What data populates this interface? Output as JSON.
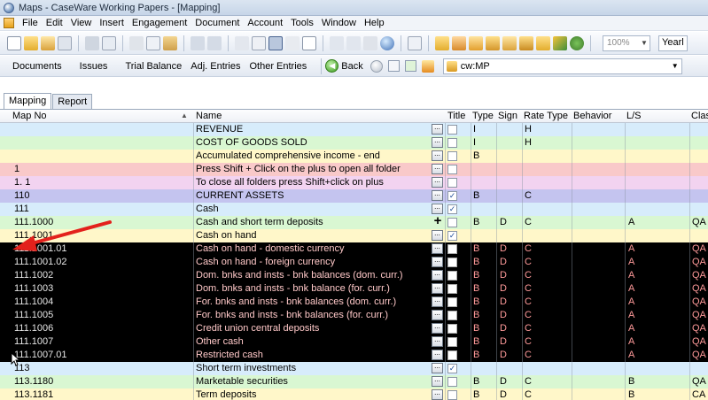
{
  "window": {
    "title": "Maps - CaseWare Working Papers - [Mapping]"
  },
  "menu": [
    "File",
    "Edit",
    "View",
    "Insert",
    "Engagement",
    "Document",
    "Account",
    "Tools",
    "Window",
    "Help"
  ],
  "toolbar": {
    "zoom": "100%",
    "period": "Yearl"
  },
  "nav": {
    "documents": "Documents",
    "issues": "Issues",
    "trial_balance": "Trial Balance",
    "adj_entries": "Adj. Entries",
    "other_entries": "Other Entries",
    "back": "Back",
    "address": "cw:MP"
  },
  "tabs": [
    "Mapping",
    "Report"
  ],
  "columns": {
    "map_no": "Map No",
    "name": "Name",
    "title": "Title",
    "type": "Type",
    "sign": "Sign",
    "rate_type": "Rate Type",
    "behavior": "Behavior",
    "ls": "L/S",
    "class": "Clas"
  },
  "colors": {
    "blue_row": "#d7ecfb",
    "green_row": "#d9f7d2",
    "yellow_row": "#fff7c9",
    "pink_row": "#f9c9c9",
    "lavender_row": "#f2d3f0",
    "purple_row": "#c4c4ef",
    "selected_row": "#000000",
    "arrow": "#e3211c"
  },
  "rows": [
    {
      "map_no": "",
      "name": "REVENUE",
      "title": false,
      "type": "I",
      "sign": "",
      "rate_type": "H",
      "ls": "",
      "cls": "",
      "bg": "#d7ecfb",
      "style": "normal"
    },
    {
      "map_no": "",
      "name": "COST OF GOODS SOLD",
      "title": false,
      "type": "I",
      "sign": "",
      "rate_type": "H",
      "ls": "",
      "cls": "",
      "bg": "#d9f7d2",
      "style": "normal"
    },
    {
      "map_no": "",
      "name": "Accumulated comprehensive income - end",
      "title": false,
      "type": "B",
      "sign": "",
      "rate_type": "",
      "ls": "",
      "cls": "",
      "bg": "#fff7c9",
      "style": "normal"
    },
    {
      "map_no": "1",
      "name": "Press Shift + Click on the plus to open all folder",
      "title": false,
      "type": "",
      "sign": "",
      "rate_type": "",
      "ls": "",
      "cls": "",
      "bg": "#f9c9c9",
      "style": "normal"
    },
    {
      "map_no": "1. 1",
      "name": "To close all folders press Shift+click on plus",
      "title": false,
      "type": "",
      "sign": "",
      "rate_type": "",
      "ls": "",
      "cls": "",
      "bg": "#f2d3f0",
      "style": "normal"
    },
    {
      "map_no": "110",
      "name": "CURRENT ASSETS",
      "title": true,
      "type": "B",
      "sign": "",
      "rate_type": "C",
      "ls": "",
      "cls": "",
      "bg": "#c4c4ef",
      "style": "normal"
    },
    {
      "map_no": "111",
      "name": "Cash",
      "title": true,
      "type": "",
      "sign": "",
      "rate_type": "",
      "ls": "",
      "cls": "",
      "bg": "#d7ecfb",
      "style": "normal"
    },
    {
      "map_no": "111.1000",
      "name": "Cash and short term deposits",
      "title": false,
      "type": "B",
      "sign": "D",
      "rate_type": "C",
      "ls": "A",
      "cls": "QA",
      "bg": "#d9f7d2",
      "style": "plus"
    },
    {
      "map_no": "111.1001",
      "name": "Cash on hand",
      "title": true,
      "type": "",
      "sign": "",
      "rate_type": "",
      "ls": "",
      "cls": "",
      "bg": "#fff7c9",
      "style": "normal"
    },
    {
      "map_no": "111.1001.01",
      "name": "Cash on hand - domestic currency",
      "title": false,
      "type": "B",
      "sign": "D",
      "rate_type": "C",
      "ls": "A",
      "cls": "QA",
      "bg": "#000000",
      "style": "dark"
    },
    {
      "map_no": "111.1001.02",
      "name": "Cash on hand - foreign currency",
      "title": false,
      "type": "B",
      "sign": "D",
      "rate_type": "C",
      "ls": "A",
      "cls": "QA",
      "bg": "#000000",
      "style": "dark"
    },
    {
      "map_no": "111.1002",
      "name": "Dom. bnks and insts - bnk balances (dom. curr.)",
      "title": false,
      "type": "B",
      "sign": "D",
      "rate_type": "C",
      "ls": "A",
      "cls": "QA",
      "bg": "#000000",
      "style": "dark"
    },
    {
      "map_no": "111.1003",
      "name": "Dom. bnks and insts - bnk balance (for. curr.)",
      "title": false,
      "type": "B",
      "sign": "D",
      "rate_type": "C",
      "ls": "A",
      "cls": "QA",
      "bg": "#000000",
      "style": "dark"
    },
    {
      "map_no": "111.1004",
      "name": "For. bnks and insts - bnk balances (dom. curr.)",
      "title": false,
      "type": "B",
      "sign": "D",
      "rate_type": "C",
      "ls": "A",
      "cls": "QA",
      "bg": "#000000",
      "style": "dark"
    },
    {
      "map_no": "111.1005",
      "name": "For. bnks and insts - bnk balances (for. curr.)",
      "title": false,
      "type": "B",
      "sign": "D",
      "rate_type": "C",
      "ls": "A",
      "cls": "QA",
      "bg": "#000000",
      "style": "dark"
    },
    {
      "map_no": "111.1006",
      "name": "Credit union central deposits",
      "title": false,
      "type": "B",
      "sign": "D",
      "rate_type": "C",
      "ls": "A",
      "cls": "QA",
      "bg": "#000000",
      "style": "dark"
    },
    {
      "map_no": "111.1007",
      "name": "Other cash",
      "title": false,
      "type": "B",
      "sign": "D",
      "rate_type": "C",
      "ls": "A",
      "cls": "QA",
      "bg": "#000000",
      "style": "dark"
    },
    {
      "map_no": "111.1007.01",
      "name": "Restricted cash",
      "title": false,
      "type": "B",
      "sign": "D",
      "rate_type": "C",
      "ls": "A",
      "cls": "QA",
      "bg": "#000000",
      "style": "dark"
    },
    {
      "map_no": "113",
      "name": "Short term investments",
      "title": true,
      "type": "",
      "sign": "",
      "rate_type": "",
      "ls": "",
      "cls": "",
      "bg": "#d7ecfb",
      "style": "normal"
    },
    {
      "map_no": "113.1180",
      "name": "Marketable securities",
      "title": false,
      "type": "B",
      "sign": "D",
      "rate_type": "C",
      "ls": "B",
      "cls": "QA",
      "bg": "#d9f7d2",
      "style": "normal"
    },
    {
      "map_no": "113.1181",
      "name": "Term deposits",
      "title": false,
      "type": "B",
      "sign": "D",
      "rate_type": "C",
      "ls": "B",
      "cls": "CA",
      "bg": "#fff7c9",
      "style": "normal"
    }
  ]
}
